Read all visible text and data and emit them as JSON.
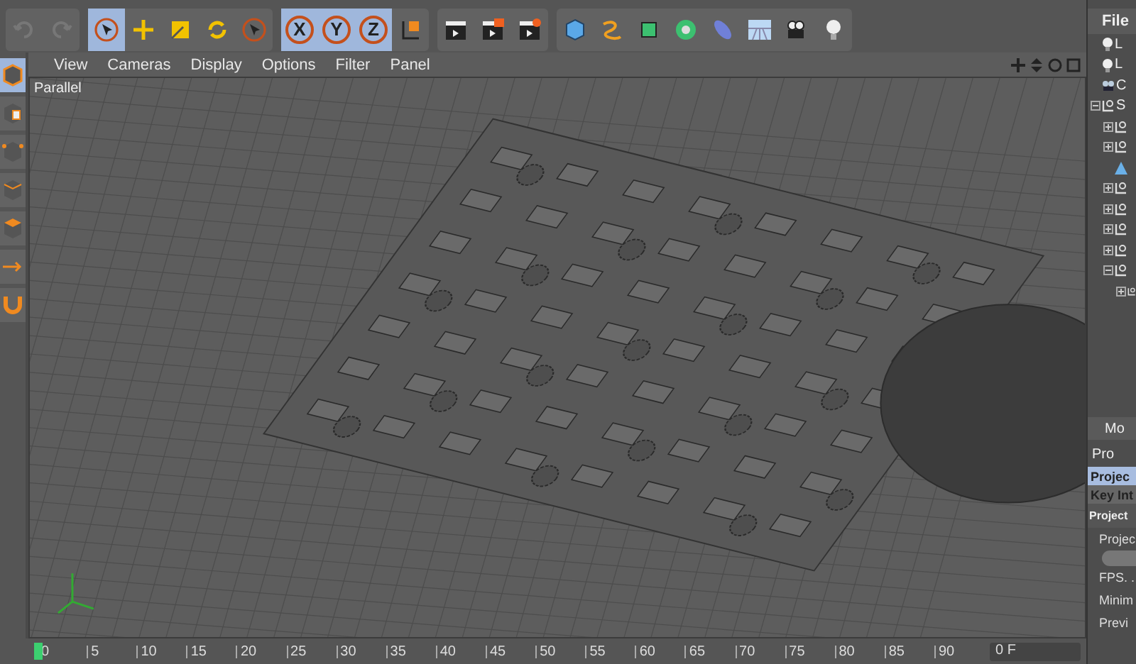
{
  "tools": [
    {
      "kind": "select",
      "selected": true
    },
    {
      "kind": "move",
      "selected": false
    },
    {
      "kind": "scale",
      "selected": false
    },
    {
      "kind": "rotate",
      "selected": false
    },
    {
      "kind": "live-select",
      "selected": false
    }
  ],
  "axes": [
    {
      "label": "X",
      "selected": true
    },
    {
      "label": "Y",
      "selected": true
    },
    {
      "label": "Z",
      "selected": true
    }
  ],
  "viewport": {
    "menu": [
      "View",
      "Cameras",
      "Display",
      "Options",
      "Filter",
      "Panel"
    ],
    "camera": "Parallel"
  },
  "timeline": {
    "ticks": [
      "0",
      "5",
      "10",
      "15",
      "20",
      "25",
      "30",
      "35",
      "40",
      "45",
      "50",
      "55",
      "60",
      "65",
      "70",
      "75",
      "80",
      "85",
      "90"
    ],
    "current_frame": "0 F"
  },
  "object_manager": {
    "menu": "File",
    "items": [
      {
        "kind": "light",
        "label": "L"
      },
      {
        "kind": "light",
        "label": "L"
      },
      {
        "kind": "camera",
        "label": "C"
      },
      {
        "kind": "null",
        "label": "S",
        "expanded": true,
        "children": [
          {
            "kind": "null",
            "expanded": false
          },
          {
            "kind": "null",
            "expanded": false
          },
          {
            "kind": "cone"
          },
          {
            "kind": "null",
            "expanded": false
          },
          {
            "kind": "null",
            "expanded": false
          },
          {
            "kind": "null",
            "expanded": false
          },
          {
            "kind": "null",
            "expanded": false
          },
          {
            "kind": "null",
            "expanded": true,
            "children": [
              {
                "kind": "null",
                "expanded": false
              }
            ]
          }
        ]
      }
    ]
  },
  "attributes": {
    "title": "Mo",
    "mode": "Pro",
    "tabs": [
      {
        "label": "Projec",
        "selected": true
      },
      {
        "label": "Key Int",
        "selected": false
      }
    ],
    "section": "Project",
    "fields": [
      {
        "kind": "slider",
        "label": "Projec"
      },
      {
        "kind": "text",
        "label": "FPS. ."
      },
      {
        "kind": "text",
        "label": "Minim"
      },
      {
        "kind": "text",
        "label": "Previ"
      }
    ]
  }
}
